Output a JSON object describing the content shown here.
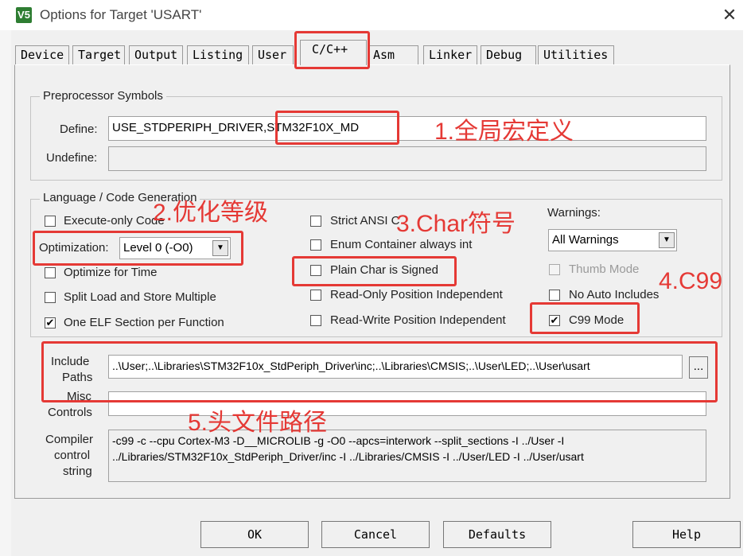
{
  "window": {
    "title": "Options for Target 'USART'",
    "app_icon": "V5",
    "close_glyph": "✕"
  },
  "tabs": [
    {
      "label": "Device"
    },
    {
      "label": "Target"
    },
    {
      "label": "Output"
    },
    {
      "label": "Listing"
    },
    {
      "label": "User"
    },
    {
      "label": "C/C++"
    },
    {
      "label": "Asm"
    },
    {
      "label": "Linker"
    },
    {
      "label": "Debug"
    },
    {
      "label": "Utilities"
    }
  ],
  "preprocessor": {
    "group_label": "Preprocessor Symbols",
    "define_label": "Define:",
    "define_value": "USE_STDPERIPH_DRIVER,STM32F10X_MD",
    "undefine_label": "Undefine:",
    "undefine_value": ""
  },
  "language": {
    "group_label": "Language / Code Generation",
    "execute_only": "Execute-only Code",
    "optimization_label": "Optimization:",
    "optimization_value": "Level 0 (-O0)",
    "optimize_time": "Optimize for Time",
    "split_load": "Split Load and Store Multiple",
    "one_elf": "One ELF Section per Function",
    "strict_ansi": "Strict ANSI C",
    "enum_int": "Enum Container always int",
    "plain_char": "Plain Char is Signed",
    "ro_pos": "Read-Only Position Independent",
    "rw_pos": "Read-Write Position Independent",
    "warnings_label": "Warnings:",
    "warnings_value": "All Warnings",
    "thumb_mode": "Thumb Mode",
    "no_auto": "No Auto Includes",
    "c99": "C99 Mode",
    "check_glyph": "✔",
    "dd_glyph": "▼"
  },
  "paths": {
    "include_label_1": "Include",
    "include_label_2": "Paths",
    "include_value": "..\\User;..\\Libraries\\STM32F10x_StdPeriph_Driver\\inc;..\\Libraries\\CMSIS;..\\User\\LED;..\\User\\usart",
    "browse": "...",
    "misc_label_1": "Misc",
    "misc_label_2": "Controls",
    "misc_value": "",
    "compiler_label_1": "Compiler",
    "compiler_label_2": "control",
    "compiler_label_3": "string",
    "compiler_line_1": "-c99 -c --cpu Cortex-M3 -D__MICROLIB -g -O0 --apcs=interwork --split_sections -I ../User -I",
    "compiler_line_2": "../Libraries/STM32F10x_StdPeriph_Driver/inc -I ../Libraries/CMSIS -I ../User/LED -I ../User/usart"
  },
  "buttons": {
    "ok": "OK",
    "cancel": "Cancel",
    "defaults": "Defaults",
    "help": "Help"
  },
  "annotations": {
    "a1": "1.全局宏定义",
    "a2": "2.优化等级",
    "a3": "3.Char符号",
    "a4": "4.C99",
    "a5": "5.头文件路径"
  },
  "colors": {
    "annotation": "#e53935",
    "dialog_bg": "#f0f0f0"
  }
}
